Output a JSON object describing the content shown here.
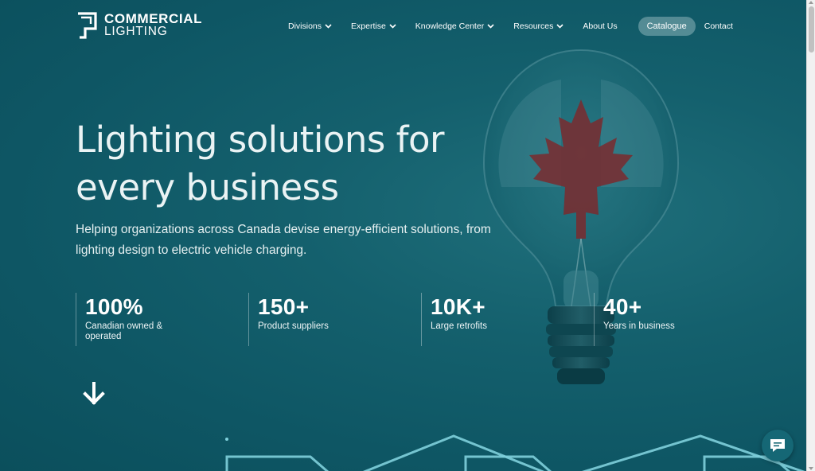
{
  "logo": {
    "line1": "COMMERCIAL",
    "line2": "LIGHTING",
    "icon": "commercial-lighting-logo-mark"
  },
  "nav": {
    "items": [
      {
        "label": "Divisions",
        "dropdown": true
      },
      {
        "label": "Expertise",
        "dropdown": true
      },
      {
        "label": "Knowledge Center",
        "dropdown": true
      },
      {
        "label": "Resources",
        "dropdown": true
      },
      {
        "label": "About Us",
        "dropdown": false
      }
    ],
    "catalogue": "Catalogue",
    "contact": "Contact"
  },
  "hero": {
    "headline_line1": "Lighting solutions for",
    "headline_line2": "every business",
    "subtext": "Helping organizations across Canada devise energy-efficient solutions, from lighting design to electric vehicle charging."
  },
  "stats": [
    {
      "value": "100%",
      "label": "Canadian owned & operated"
    },
    {
      "value": "150+",
      "label": "Product suppliers"
    },
    {
      "value": "10K+",
      "label": "Large retrofits"
    },
    {
      "value": "40+",
      "label": "Years in business"
    }
  ],
  "icons": {
    "scroll_down": "arrow-down-icon",
    "chat": "chat-bubble-icon",
    "nav_dropdown": "chevron-down-icon"
  },
  "colors": {
    "background": "#0f5e6b",
    "text": "#ffffff",
    "catalogue_button": "#5e8f97",
    "maple_leaf": "#8a2a2a"
  }
}
